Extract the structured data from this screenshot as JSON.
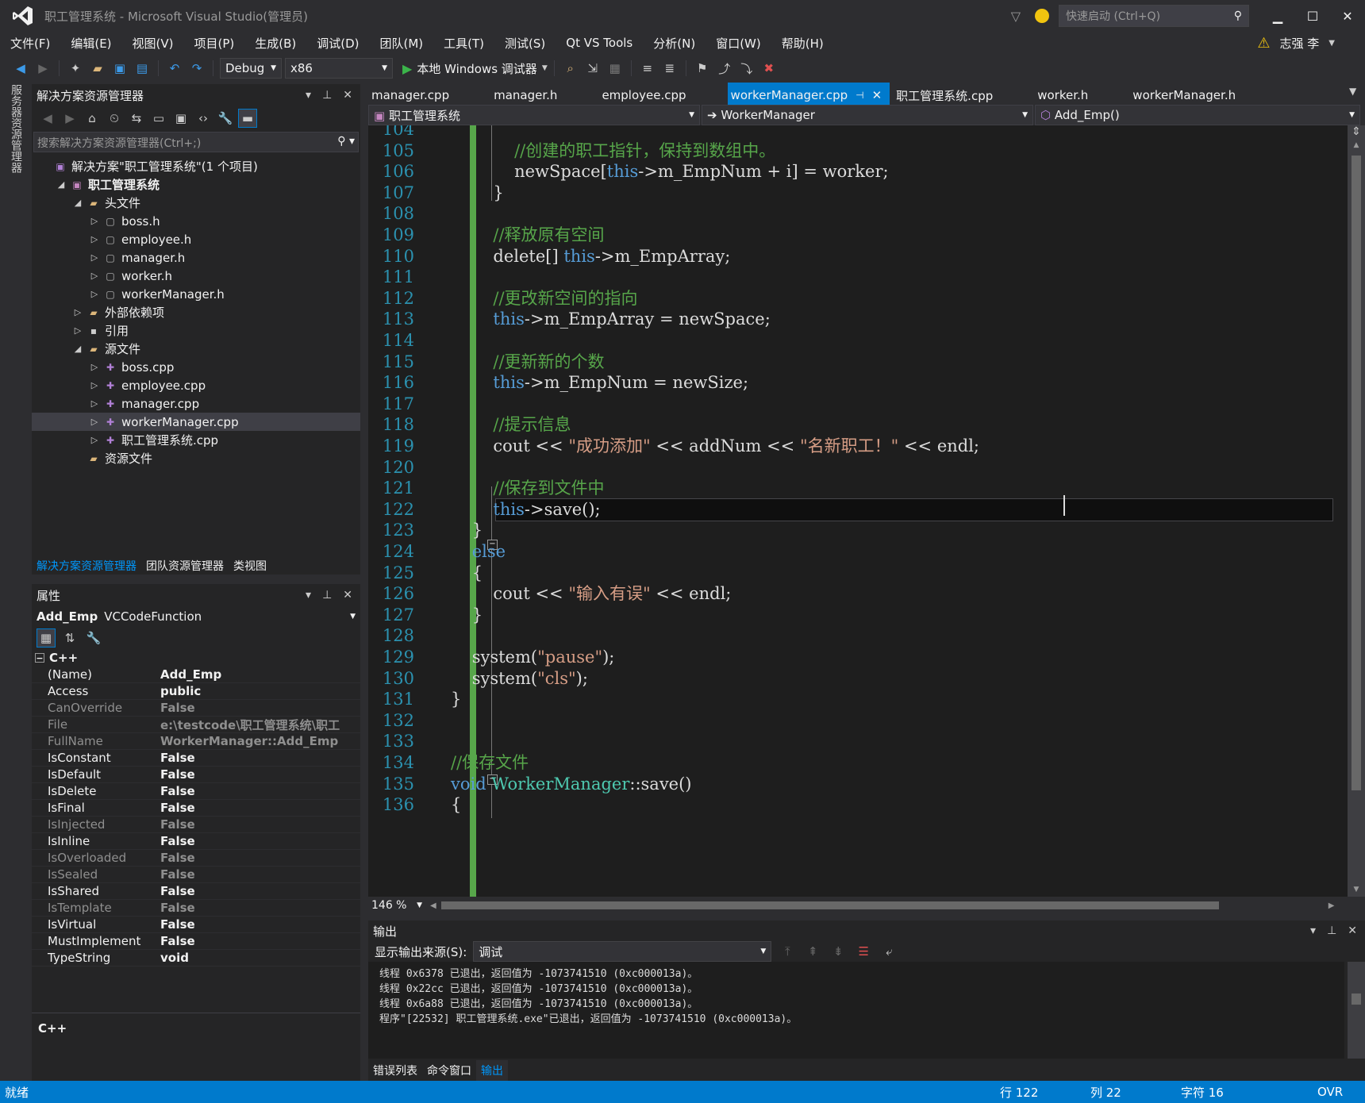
{
  "window": {
    "title": "职工管理系统 - Microsoft Visual Studio(管理员)",
    "quick_launch_placeholder": "快速启动 (Ctrl+Q)",
    "user": "志强 李"
  },
  "menu": [
    "文件(F)",
    "编辑(E)",
    "视图(V)",
    "项目(P)",
    "生成(B)",
    "调试(D)",
    "团队(M)",
    "工具(T)",
    "测试(S)",
    "Qt VS Tools",
    "分析(N)",
    "窗口(W)",
    "帮助(H)"
  ],
  "toolbar": {
    "config": "Debug",
    "platform": "x86",
    "run_label": "本地 Windows 调试器"
  },
  "side_strip": "服务器资源管理器",
  "solution_explorer": {
    "title": "解决方案资源管理器",
    "search_placeholder": "搜索解决方案资源管理器(Ctrl+;)",
    "tree": [
      {
        "label": "解决方案\"职工管理系统\"(1 个项目)",
        "level": 0,
        "icon": "solution-icon",
        "expand": ""
      },
      {
        "label": "职工管理系统",
        "level": 1,
        "icon": "project-icon",
        "expand": "open",
        "bold": true
      },
      {
        "label": "头文件",
        "level": 2,
        "icon": "folder-icon",
        "expand": "open"
      },
      {
        "label": "boss.h",
        "level": 3,
        "icon": "header-file-icon",
        "expand": "closed"
      },
      {
        "label": "employee.h",
        "level": 3,
        "icon": "header-file-icon",
        "expand": "closed"
      },
      {
        "label": "manager.h",
        "level": 3,
        "icon": "header-file-icon",
        "expand": "closed"
      },
      {
        "label": "worker.h",
        "level": 3,
        "icon": "header-file-icon",
        "expand": "closed"
      },
      {
        "label": "workerManager.h",
        "level": 3,
        "icon": "header-file-icon",
        "expand": "closed"
      },
      {
        "label": "外部依赖项",
        "level": 2,
        "icon": "folder-icon",
        "expand": "closed"
      },
      {
        "label": "引用",
        "level": 2,
        "icon": "reference-icon",
        "expand": "closed"
      },
      {
        "label": "源文件",
        "level": 2,
        "icon": "folder-icon",
        "expand": "open"
      },
      {
        "label": "boss.cpp",
        "level": 3,
        "icon": "cpp-file-icon",
        "expand": "closed"
      },
      {
        "label": "employee.cpp",
        "level": 3,
        "icon": "cpp-file-icon",
        "expand": "closed"
      },
      {
        "label": "manager.cpp",
        "level": 3,
        "icon": "cpp-file-icon",
        "expand": "closed"
      },
      {
        "label": "workerManager.cpp",
        "level": 3,
        "icon": "cpp-file-icon",
        "expand": "closed",
        "selected": true
      },
      {
        "label": "职工管理系统.cpp",
        "level": 3,
        "icon": "cpp-file-icon",
        "expand": "closed"
      },
      {
        "label": "资源文件",
        "level": 2,
        "icon": "folder-icon",
        "expand": ""
      }
    ],
    "bottom_tabs": [
      "解决方案资源管理器",
      "团队资源管理器",
      "类视图"
    ]
  },
  "properties": {
    "title": "属性",
    "object_name": "Add_Emp",
    "object_type": "VCCodeFunction",
    "category": "C++",
    "rows": [
      {
        "k": "(Name)",
        "v": "Add_Emp",
        "dim": false
      },
      {
        "k": "Access",
        "v": "public",
        "dim": false
      },
      {
        "k": "CanOverride",
        "v": "False",
        "dim": true
      },
      {
        "k": "File",
        "v": "e:\\testcode\\职工管理系统\\职工",
        "dim": true
      },
      {
        "k": "FullName",
        "v": "WorkerManager::Add_Emp",
        "dim": true
      },
      {
        "k": "IsConstant",
        "v": "False",
        "dim": false
      },
      {
        "k": "IsDefault",
        "v": "False",
        "dim": false
      },
      {
        "k": "IsDelete",
        "v": "False",
        "dim": false
      },
      {
        "k": "IsFinal",
        "v": "False",
        "dim": false
      },
      {
        "k": "IsInjected",
        "v": "False",
        "dim": true
      },
      {
        "k": "IsInline",
        "v": "False",
        "dim": false
      },
      {
        "k": "IsOverloaded",
        "v": "False",
        "dim": true
      },
      {
        "k": "IsSealed",
        "v": "False",
        "dim": true
      },
      {
        "k": "IsShared",
        "v": "False",
        "dim": false
      },
      {
        "k": "IsTemplate",
        "v": "False",
        "dim": true
      },
      {
        "k": "IsVirtual",
        "v": "False",
        "dim": false
      },
      {
        "k": "MustImplement",
        "v": "False",
        "dim": false
      },
      {
        "k": "TypeString",
        "v": "void",
        "dim": false
      }
    ],
    "description": "C++"
  },
  "doc_tabs": [
    {
      "label": "manager.cpp",
      "active": false
    },
    {
      "label": "manager.h",
      "active": false
    },
    {
      "label": "employee.cpp",
      "active": false
    },
    {
      "label": "workerManager.cpp",
      "active": true
    },
    {
      "label": "职工管理系统.cpp",
      "active": false
    },
    {
      "label": "worker.h",
      "active": false
    },
    {
      "label": "workerManager.h",
      "active": false
    }
  ],
  "nav": {
    "project": "职工管理系统",
    "class": "WorkerManager",
    "member": "Add_Emp()"
  },
  "editor": {
    "zoom": "146 %",
    "lines": [
      {
        "n": "104",
        "s": []
      },
      {
        "n": "105",
        "s": [
          [
            "            ",
            ""
          ],
          [
            "//创建的职工指针，保持到数组中。",
            "cm"
          ]
        ]
      },
      {
        "n": "106",
        "s": [
          [
            "            newSpace[",
            ""
          ],
          [
            "this",
            "kw"
          ],
          [
            "->m_EmpNum + i] = worker;",
            ""
          ]
        ]
      },
      {
        "n": "107",
        "s": [
          [
            "        }",
            ""
          ]
        ]
      },
      {
        "n": "108",
        "s": []
      },
      {
        "n": "109",
        "s": [
          [
            "        ",
            ""
          ],
          [
            "//释放原有空间",
            "cm"
          ]
        ]
      },
      {
        "n": "110",
        "s": [
          [
            "        delete[] ",
            ""
          ],
          [
            "this",
            "kw"
          ],
          [
            "->m_EmpArray;",
            ""
          ]
        ]
      },
      {
        "n": "111",
        "s": []
      },
      {
        "n": "112",
        "s": [
          [
            "        ",
            ""
          ],
          [
            "//更改新空间的指向",
            "cm"
          ]
        ]
      },
      {
        "n": "113",
        "s": [
          [
            "        ",
            ""
          ],
          [
            "this",
            "kw"
          ],
          [
            "->m_EmpArray = newSpace;",
            ""
          ]
        ]
      },
      {
        "n": "114",
        "s": []
      },
      {
        "n": "115",
        "s": [
          [
            "        ",
            ""
          ],
          [
            "//更新新的个数",
            "cm"
          ]
        ]
      },
      {
        "n": "116",
        "s": [
          [
            "        ",
            ""
          ],
          [
            "this",
            "kw"
          ],
          [
            "->m_EmpNum = newSize;",
            ""
          ]
        ]
      },
      {
        "n": "117",
        "s": []
      },
      {
        "n": "118",
        "s": [
          [
            "        ",
            ""
          ],
          [
            "//提示信息",
            "cm"
          ]
        ]
      },
      {
        "n": "119",
        "s": [
          [
            "        cout << ",
            ""
          ],
          [
            "\"成功添加\"",
            "st"
          ],
          [
            " << addNum << ",
            ""
          ],
          [
            "\"名新职工！\"",
            "st"
          ],
          [
            " << endl;",
            ""
          ]
        ]
      },
      {
        "n": "120",
        "s": []
      },
      {
        "n": "121",
        "s": [
          [
            "        ",
            ""
          ],
          [
            "//保存到文件中",
            "cm"
          ]
        ]
      },
      {
        "n": "122",
        "s": [
          [
            "        ",
            ""
          ],
          [
            "this",
            "kw"
          ],
          [
            "->save();",
            ""
          ]
        ]
      },
      {
        "n": "123",
        "s": [
          [
            "    }",
            ""
          ]
        ]
      },
      {
        "n": "124",
        "s": [
          [
            "    ",
            ""
          ],
          [
            "else",
            "kw"
          ]
        ]
      },
      {
        "n": "125",
        "s": [
          [
            "    {",
            ""
          ]
        ]
      },
      {
        "n": "126",
        "s": [
          [
            "        cout << ",
            ""
          ],
          [
            "\"输入有误\"",
            "st"
          ],
          [
            " << endl;",
            ""
          ]
        ]
      },
      {
        "n": "127",
        "s": [
          [
            "    }",
            ""
          ]
        ]
      },
      {
        "n": "128",
        "s": []
      },
      {
        "n": "129",
        "s": [
          [
            "    system(",
            ""
          ],
          [
            "\"pause\"",
            "st"
          ],
          [
            ");",
            ""
          ]
        ]
      },
      {
        "n": "130",
        "s": [
          [
            "    system(",
            ""
          ],
          [
            "\"cls\"",
            "st"
          ],
          [
            ");",
            ""
          ]
        ]
      },
      {
        "n": "131",
        "s": [
          [
            "}",
            ""
          ]
        ]
      },
      {
        "n": "132",
        "s": []
      },
      {
        "n": "133",
        "s": []
      },
      {
        "n": "134",
        "s": [
          [
            "",
            ""
          ],
          [
            "//保存文件",
            "cm"
          ]
        ]
      },
      {
        "n": "135",
        "s": [
          [
            "",
            ""
          ],
          [
            "void",
            "kw"
          ],
          [
            " ",
            ""
          ],
          [
            "WorkerManager",
            "ty"
          ],
          [
            "::save()",
            ""
          ]
        ]
      },
      {
        "n": "136",
        "s": [
          [
            "{",
            ""
          ]
        ]
      }
    ]
  },
  "output": {
    "title": "输出",
    "source_label": "显示输出来源(S):",
    "source_value": "调试",
    "text": "线程 0x6378 已退出，返回值为 -1073741510 (0xc000013a)。\n线程 0x22cc 已退出，返回值为 -1073741510 (0xc000013a)。\n线程 0x6a88 已退出，返回值为 -1073741510 (0xc000013a)。\n程序\"[22532] 职工管理系统.exe\"已退出，返回值为 -1073741510 (0xc000013a)。",
    "bottom_tabs": [
      "错误列表",
      "命令窗口",
      "输出"
    ]
  },
  "status": {
    "ready": "就绪",
    "line": "行 122",
    "col": "列 22",
    "ch": "字符 16",
    "ovr": "OVR"
  },
  "colors": {
    "accent": "#007acc",
    "comment": "#57a64a",
    "keyword": "#569cd6",
    "string": "#d69d85",
    "type": "#4ec9b0",
    "linenum": "#2b91af"
  }
}
